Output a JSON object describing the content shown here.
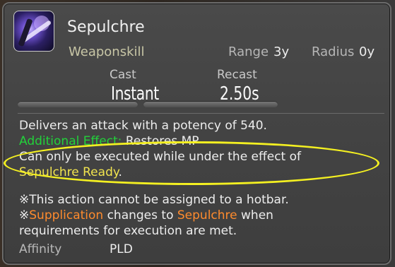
{
  "action": {
    "name": "Sepulchre",
    "type": "Weaponskill",
    "icon": "sword-strike-icon",
    "range_label": "Range",
    "range_value": "3y",
    "radius_label": "Radius",
    "radius_value": "0y"
  },
  "timing": {
    "cast_label": "Cast",
    "cast_value": "Instant",
    "recast_label": "Recast",
    "recast_value": "2.50s"
  },
  "description": {
    "line1": "Delivers an attack with a potency of 540.",
    "additional_effect_label": "Additional Effect:",
    "additional_effect_text": "Restores MP",
    "condition_text": "Can only be executed while under the effect of",
    "condition_status": "Sepulchre Ready",
    "condition_end": ".",
    "note1": "※This action cannot be assigned to a hotbar.",
    "note2_prefix": "※",
    "note2_action": "Supplication",
    "note2_mid": "changes to",
    "note2_target": "Sepulchre",
    "note2_end": "when",
    "note3": "requirements for execution are met."
  },
  "affinity": {
    "label": "Affinity",
    "value": "PLD"
  },
  "colors": {
    "additional_effect": "#22d13a",
    "status_highlight": "#f1e44f",
    "action_link": "#ff8b2d",
    "annotation_ring": "#f4f021"
  }
}
